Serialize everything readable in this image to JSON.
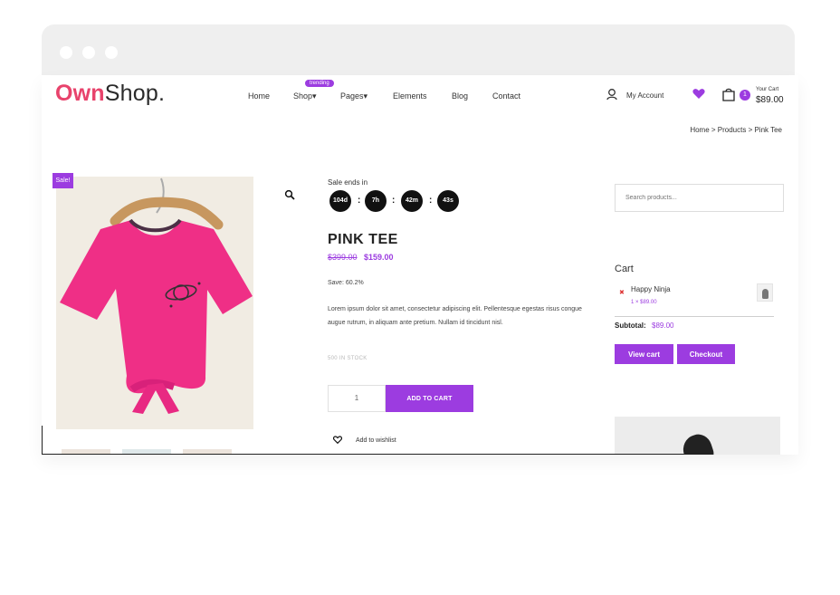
{
  "browser": {
    "dots": [
      "window-dot-1",
      "window-dot-2",
      "window-dot-3"
    ]
  },
  "brand": {
    "name_part_1": "Own",
    "name_part_2": "Shop."
  },
  "nav": {
    "items": [
      "Home",
      "Shop▾",
      "Pages▾",
      "Elements",
      "Blog",
      "Contact"
    ],
    "shop_badge": "trending"
  },
  "header": {
    "account_label": "My Account",
    "cart_label": "Your Cart",
    "cart_total": "$89.00",
    "cart_count": "1"
  },
  "breadcrumb": {
    "text": "Home >  Products > Pink Tee"
  },
  "product": {
    "sale_badge": "Sale!",
    "sale_ends_label": "Sale ends in",
    "countdown": [
      "104d",
      "7h",
      "42m",
      "43s"
    ],
    "title": "PINK TEE",
    "old_price": "$399.00",
    "new_price": "$159.00",
    "save": "Save: 60.2%",
    "description": "Lorem ipsum dolor sit amet, consectetur adipiscing elit. Pellentesque egestas risus congue augue rutrum, in aliquam ante pretium. Nullam id tincidunt nisl.",
    "stock": "500 IN STOCK",
    "quantity": "1",
    "add_to_cart": "ADD TO CART",
    "wishlist": "Add to wishlist"
  },
  "sidebar": {
    "search_placeholder": "Search products...",
    "cart_title": "Cart",
    "cart_item_name": "Happy Ninja",
    "cart_item_price": "1 × $89.00",
    "subtotal_label": "Subtotal:",
    "subtotal_value": "$89.00",
    "view_cart": "View cart",
    "checkout": "Checkout"
  },
  "colors": {
    "brand_pink": "#e8436c",
    "accent_purple": "#9c3ce0",
    "tee_pink": "#ef2f86",
    "image_bg": "#f1ece3"
  },
  "icons": [
    "account-icon",
    "heart-icon",
    "cart-icon",
    "search-icon",
    "zoom-icon",
    "wishlist-heart-icon",
    "remove-icon"
  ]
}
